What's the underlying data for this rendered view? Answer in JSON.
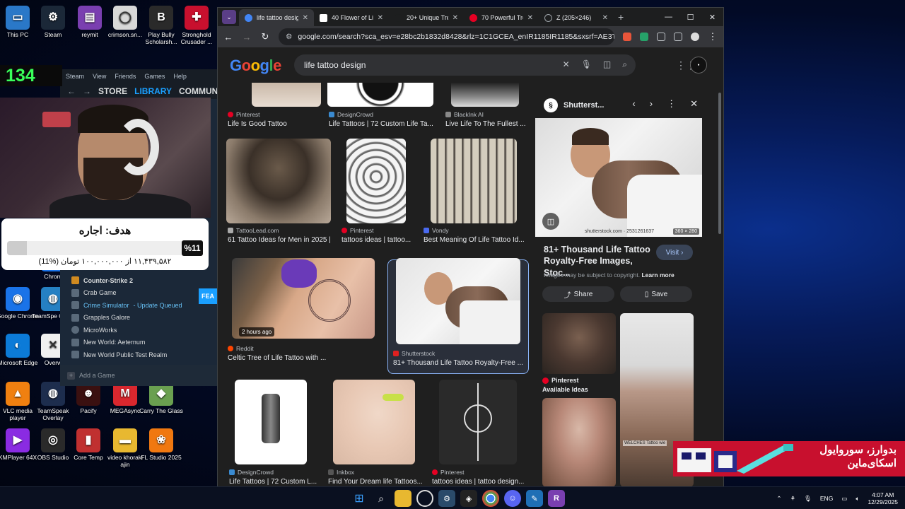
{
  "desktop": {
    "icons": [
      {
        "label": "This PC",
        "color": "#2a78c8",
        "glyph": "▭"
      },
      {
        "label": "Steam",
        "color": "#1b2838",
        "glyph": "⚙"
      },
      {
        "label": "reymit",
        "color": "#7a3fb0",
        "glyph": "▤"
      },
      {
        "label": "crimson.sn...",
        "color": "#d8d8d8",
        "glyph": "◯"
      },
      {
        "label": "Play Bully Scholarsh...",
        "color": "#2a2a2a",
        "glyph": "B"
      },
      {
        "label": "Stronghold Crusader ...",
        "color": "#c8102e",
        "glyph": "✚"
      },
      {
        "label": "Chrom",
        "color": "#1a73e8",
        "glyph": "◉"
      },
      {
        "label": "Google Chrome",
        "color": "#1a73e8",
        "glyph": "◉"
      },
      {
        "label": "TeamSpe Client",
        "color": "#2580c3",
        "glyph": "◍"
      },
      {
        "label": "Microsoft Edge",
        "color": "#0c7bd8",
        "glyph": "◐"
      },
      {
        "label": "Overw",
        "color": "#f0f0f0",
        "glyph": "✕"
      },
      {
        "label": "VLC media player",
        "color": "#f08010",
        "glyph": "▲"
      },
      {
        "label": "TeamSpeak Overlay",
        "color": "#1d2d4d",
        "glyph": "◍"
      },
      {
        "label": "Pacify",
        "color": "#3a1010",
        "glyph": "☻"
      },
      {
        "label": "MEGAsync",
        "color": "#d9272e",
        "glyph": "M"
      },
      {
        "label": "Carry The Glass",
        "color": "#6aa050",
        "glyph": "◆"
      },
      {
        "label": "KMPlayer 64X",
        "color": "#8a2be2",
        "glyph": "▶"
      },
      {
        "label": "OBS Studio",
        "color": "#2a2a2a",
        "glyph": "◎"
      },
      {
        "label": "Core Temp",
        "color": "#c03030",
        "glyph": "▮"
      },
      {
        "label": "video khoraki ajin",
        "color": "#e8b830",
        "glyph": "▬"
      },
      {
        "label": "FL Studio 2025",
        "color": "#f07810",
        "glyph": "❀"
      }
    ]
  },
  "overlay": {
    "counter": "134",
    "goal": {
      "title": "هدف: اجاره",
      "percent_label": "%11",
      "progress": 0.11,
      "text": "۱۱,۴۳۹,۵۸۲ از ۱۰۰,۰۰۰,۰۰۰ تومان (%11)"
    }
  },
  "steam": {
    "menu": [
      "Steam",
      "View",
      "Friends",
      "Games",
      "Help"
    ],
    "nav": [
      "STORE",
      "LIBRARY",
      "COMMUN"
    ],
    "games": [
      {
        "name": "Counter-Strike 2",
        "status": ""
      },
      {
        "name": "Crab Game",
        "status": ""
      },
      {
        "name": "Crime Simulator",
        "status": "- Update Queued"
      },
      {
        "name": "Grapples Galore",
        "status": ""
      },
      {
        "name": "MicroWorks",
        "status": ""
      },
      {
        "name": "New World: Aeternum",
        "status": ""
      },
      {
        "name": "New World Public Test Realm",
        "status": ""
      }
    ],
    "add_game": "Add a Game",
    "feature": "FEA"
  },
  "chrome": {
    "tabs": [
      {
        "title": "life tattoo design",
        "active": true,
        "favicon_color": "#4285f4"
      },
      {
        "title": "40 Flower of Life",
        "active": false,
        "favicon_color": "#ffffff"
      },
      {
        "title": "20+ Unique Tree",
        "active": false,
        "favicon_color": "#1d1e1f"
      },
      {
        "title": "70 Powerful Tree",
        "active": false,
        "favicon_color": "#e60023"
      },
      {
        "title": "Z (205×246)",
        "active": false,
        "favicon_color": "#9aa0a6"
      }
    ],
    "url": "google.com/search?sca_esv=e28bc2b1832d8428&rlz=1C1GCEA_enIR1185IR1185&sxsrf=AE3TifPcPJ..."
  },
  "google": {
    "logo": "Google",
    "query": "life tattoo design",
    "results": [
      {
        "source": "Pinterest",
        "title": "Life Is Good Tattoo",
        "color": "#e60023"
      },
      {
        "source": "DesignCrowd",
        "title": "Life Tattoos | 72 Custom Life Ta...",
        "color": "#3a8ad0"
      },
      {
        "source": "BlackInk AI",
        "title": "Live Life To The Fullest ...",
        "color": "#888888"
      },
      {
        "source": "TattooLead.com",
        "title": "61 Tattoo Ideas for Men in 2025 |",
        "color": "#aaaaaa"
      },
      {
        "source": "Pinterest",
        "title": "tattoos ideas | tattoo...",
        "color": "#e60023"
      },
      {
        "source": "Vondy",
        "title": "Best Meaning Of Life Tattoo Id...",
        "color": "#4a6af0"
      },
      {
        "source": "Reddit",
        "title": "Celtic Tree of Life Tattoo with ...",
        "color": "#ff4500",
        "badge": "2 hours ago"
      },
      {
        "source": "Shutterstock",
        "title": "81+ Thousand Life Tattoo Royalty-Free ...",
        "color": "#e02020"
      },
      {
        "source": "DesignCrowd",
        "title": "Life Tattoos | 72 Custom L...",
        "color": "#3a8ad0"
      },
      {
        "source": "Inkbox",
        "title": "Find Your Dream life Tattoos...",
        "color": "#555555"
      },
      {
        "source": "Pinterest",
        "title": "tattoos ideas | tattoo design...",
        "color": "#e60023"
      }
    ],
    "panel": {
      "source": "Shutterst...",
      "dimensions": "360 × 280",
      "watermark": "shutterstock.com · 2531261637",
      "title": "81+ Thousand Life Tattoo Royalty-Free Images, Stoc...",
      "visit": "Visit",
      "copyright": "Images may be subject to copyright.",
      "learn_more": "Learn more",
      "share": "Share",
      "save": "Save",
      "related_source": "Pinterest",
      "related_caption": "Available Ideas",
      "related_watermark": "WELCHES Tattoo wie"
    }
  },
  "promo": {
    "text": "بدوارز، سوروایول اسکای‌ماین"
  },
  "taskbar": {
    "lang": "ENG",
    "time": "4:07 AM",
    "date": "12/29/2025"
  }
}
